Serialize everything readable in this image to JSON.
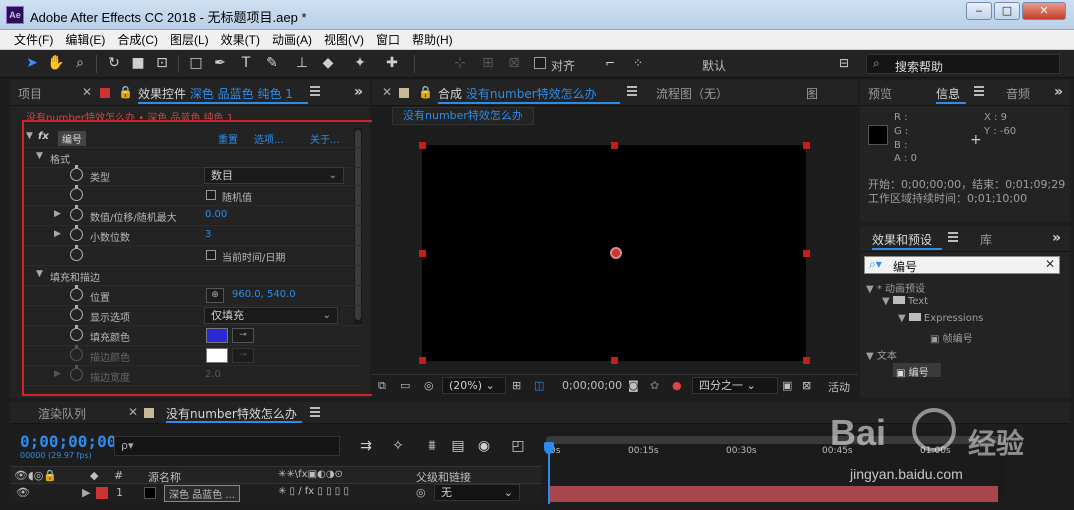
{
  "window": {
    "app_icon": "Ae",
    "title": "Adobe After Effects CC 2018 - 无标题项目.aep *",
    "min": "‒",
    "max": "□",
    "close": "✕"
  },
  "menu": [
    "文件(F)",
    "编辑(E)",
    "合成(C)",
    "图层(L)",
    "效果(T)",
    "动画(A)",
    "视图(V)",
    "窗口",
    "帮助(H)"
  ],
  "toolbar": {
    "snap_label": "对齐",
    "workspace": "默认",
    "search_placeholder": "搜索帮助"
  },
  "project_panel": {
    "tab": "项目"
  },
  "effects_panel": {
    "tab_prefix": "效果控件",
    "tab_layer": "深色 品蓝色 纯色 1",
    "subtitle": "没有number特效怎么办 • 深色 品蓝色 纯色 1",
    "effect_badge": "fx",
    "effect_name": "编号",
    "links": [
      "重置",
      "选项...",
      "关于..."
    ],
    "rows": [
      {
        "label": "格式",
        "type": "group"
      },
      {
        "label": "类型",
        "value": "数目"
      },
      {
        "label": "随机值",
        "type": "checkbox"
      },
      {
        "label": "数值/位移/随机最大",
        "value": "0.00"
      },
      {
        "label": "小数位数",
        "value": "3"
      },
      {
        "label": "当前时间/日期",
        "type": "checkbox"
      },
      {
        "label": "填充和描边",
        "type": "group"
      },
      {
        "label": "位置",
        "value": "960.0, 540.0"
      },
      {
        "label": "显示选项",
        "value": "仅填充"
      },
      {
        "label": "填充颜色",
        "color": "#2d2ad4"
      },
      {
        "label": "描边颜色",
        "color": "#ffffff"
      },
      {
        "label": "描边宽度",
        "value": "2.0"
      }
    ]
  },
  "composition_panel": {
    "tab_prefix": "合成",
    "tab_name": "没有number特效怎么办",
    "flow_tab": "流程图（无）",
    "comp_label": "没有number特效怎么办",
    "zoom": "(20%)",
    "timecode": "0;00;00;00",
    "resolution": "四分之一",
    "active_label": "活动"
  },
  "info_panel": {
    "tabs": [
      "预览",
      "信息",
      "音频"
    ],
    "rgba_labels": [
      "R :",
      "G :",
      "B :",
      "A :  0"
    ],
    "x": "X : 9",
    "y": "Y : -60",
    "line1": "开始：0;00;00;00，结束：0;01;09;29",
    "line2": "工作区域持续时间：0;01;10;00"
  },
  "effects_presets": {
    "tab": "效果和预设",
    "lib_tab": "库",
    "search_value": "编号",
    "tree": [
      {
        "label": "* 动画预设",
        "indent": 0
      },
      {
        "label": "Text",
        "indent": 1,
        "folder": true
      },
      {
        "label": "Expressions",
        "indent": 2,
        "folder": true
      },
      {
        "label": "帧编号",
        "indent": 3
      },
      {
        "label": "文本",
        "indent": 0
      },
      {
        "label": "编号",
        "indent": 1
      }
    ]
  },
  "timeline": {
    "render_tab": "渲染队列",
    "comp_tab": "没有number特效怎么办",
    "time": "0;00;00;00",
    "fps": "00000 (29.97 fps)",
    "search_placeholder": "ρ▾",
    "headers": {
      "source": "源名称",
      "parent": "父级和链接",
      "num": "#"
    },
    "row": {
      "index": "1",
      "name": "深色 品蓝色 ...",
      "parent": "无"
    },
    "ticks": [
      "0s",
      "00:15s",
      "00:30s",
      "00:45s",
      "01:00s"
    ],
    "bar_color": "#a8454d"
  },
  "watermark": {
    "brand": "Bai",
    "brand_cn": "经验",
    "url": "jingyan.baidu.com"
  }
}
